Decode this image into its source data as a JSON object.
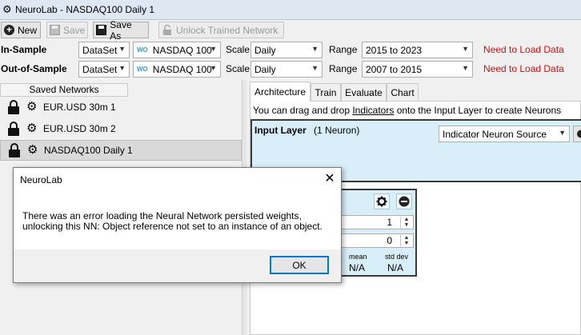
{
  "window": {
    "title": "NeuroLab - NASDAQ100 Daily 1",
    "app_icon": "gear-network-icon"
  },
  "toolbar": {
    "new_label": "New",
    "save_label": "Save",
    "saveas_label": "Save As",
    "unlock_label": "Unlock Trained Network"
  },
  "data_rows": {
    "in_sample": {
      "label": "In-Sample",
      "source": "DataSet",
      "symbol": "NASDAQ 100",
      "symbol_prefix": "WO",
      "scale_label": "Scale",
      "scale": "Daily",
      "range_label": "Range",
      "range": "2015 to 2023",
      "status": "Need to Load Data"
    },
    "out_of_sample": {
      "label": "Out-of-Sample",
      "source": "DataSet",
      "symbol": "NASDAQ 100",
      "symbol_prefix": "WO",
      "scale_label": "Scale",
      "scale": "Daily",
      "range_label": "Range",
      "range": "2007 to 2015",
      "status": "Need to Load Data"
    }
  },
  "saved_networks": {
    "header": "Saved Networks",
    "items": [
      {
        "label": "EUR.USD 30m 1"
      },
      {
        "label": "EUR.USD 30m 2"
      },
      {
        "label": "NASDAQ100 Daily 1"
      }
    ]
  },
  "tabs": [
    "Architecture",
    "Train",
    "Evaluate",
    "Chart"
  ],
  "architecture": {
    "hint_before": "You can drag and drop ",
    "hint_link": "Indicators",
    "hint_after": " onto the Input Layer to create Neurons",
    "input_layer_title": "Input Layer",
    "input_layer_count": "(1 Neuron)",
    "source_select": "Indicator Neuron Source"
  },
  "neuron": {
    "spin1": "1",
    "spin2": "0",
    "mean_label": "mean",
    "std_label": "std dev",
    "mean_value": "N/A",
    "std_value": "N/A"
  },
  "dialog": {
    "title": "NeuroLab",
    "message_line1": "There was an error loading the Neural Network persisted weights,",
    "message_line2": "unlocking this NN: Object reference not set to an instance of an object.",
    "ok_label": "OK"
  },
  "colors": {
    "status_red": "#d01010",
    "panel_blue": "#d8eef8",
    "accent": "#0078d7"
  }
}
